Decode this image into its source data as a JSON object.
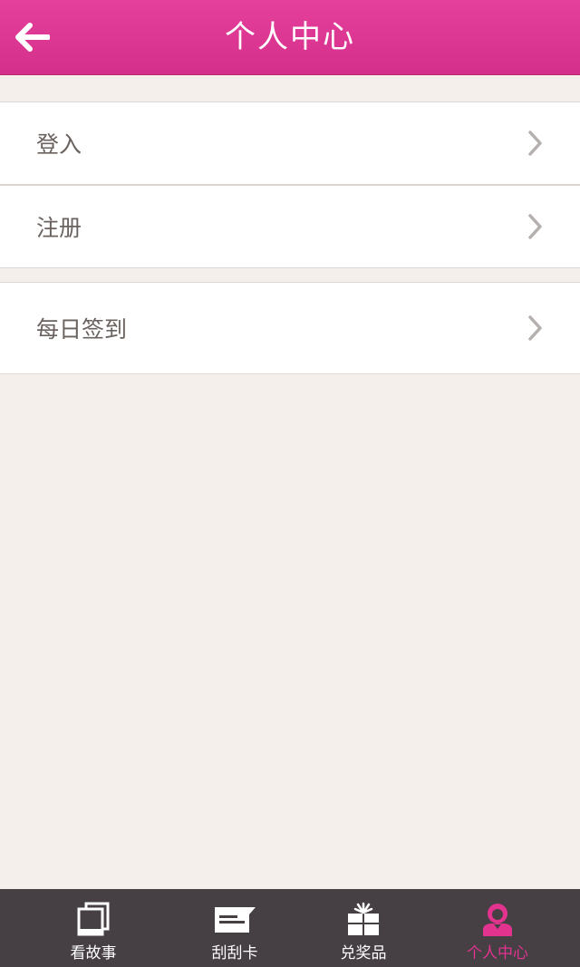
{
  "header": {
    "title": "个人中心",
    "back_icon": "arrow-left-icon"
  },
  "menu": {
    "group1": [
      {
        "label": "登入",
        "icon": "chevron-right-icon"
      },
      {
        "label": "注册",
        "icon": "chevron-right-icon"
      }
    ],
    "group2": [
      {
        "label": "每日签到",
        "icon": "chevron-right-icon"
      }
    ]
  },
  "tabbar": {
    "tabs": [
      {
        "label": "看故事",
        "icon": "photos-icon",
        "active": false
      },
      {
        "label": "刮刮卡",
        "icon": "card-icon",
        "active": false
      },
      {
        "label": "兑奖品",
        "icon": "gift-icon",
        "active": false
      },
      {
        "label": "个人中心",
        "icon": "user-icon",
        "active": true
      }
    ]
  },
  "colors": {
    "accent": "#e2338f",
    "header_bg": "#dd3894",
    "background": "#f4efeb",
    "tabbar_bg": "#463f44",
    "text": "#6a625e"
  }
}
